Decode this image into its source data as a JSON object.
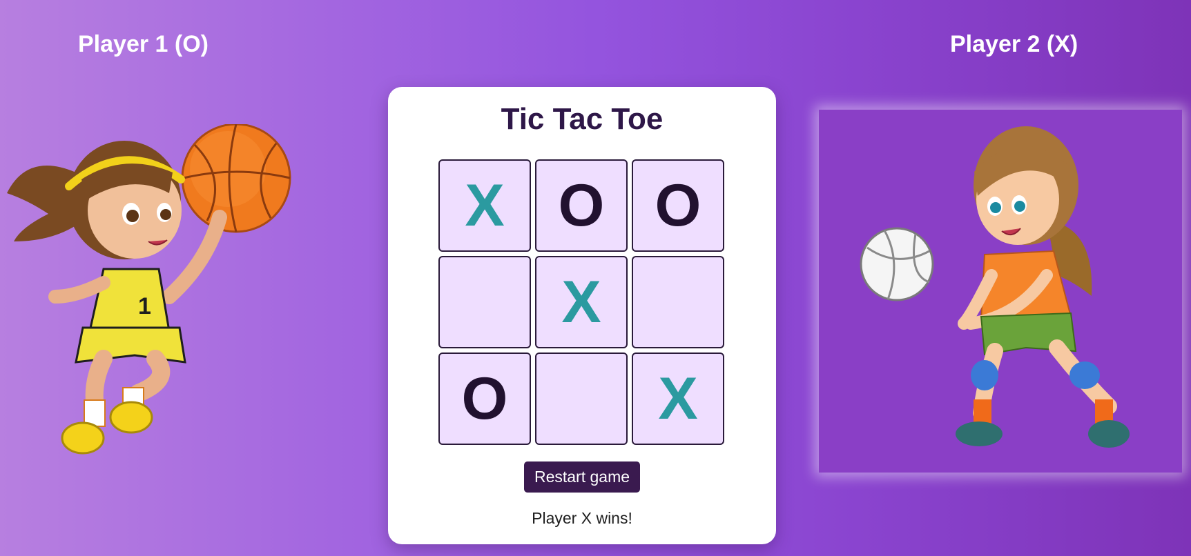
{
  "players": {
    "left": {
      "title": "Player 1 (O)",
      "art_icon": "girl-basketball-illustration"
    },
    "right": {
      "title": "Player 2 (X)",
      "art_icon": "girl-volleyball-illustration"
    }
  },
  "game": {
    "title": "Tic Tac Toe",
    "board": [
      "X",
      "O",
      "O",
      "",
      "X",
      "",
      "O",
      "",
      "X"
    ],
    "restart_label": "Restart game",
    "status": "Player X wins!"
  },
  "colors": {
    "x_mark": "#2b9aa0",
    "o_mark": "#21112f",
    "cell_bg": "#efdeff",
    "button_bg": "#3a1a4f",
    "title_text": "#2e1748"
  }
}
